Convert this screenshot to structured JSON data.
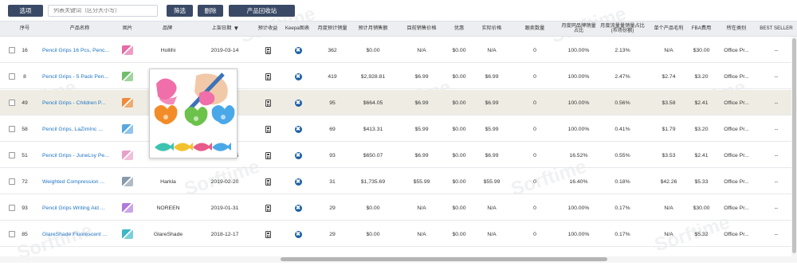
{
  "toolbar": {
    "options_label": "选项",
    "search_placeholder": "列表关键词（区分大小写）",
    "filter_label": "筛选",
    "delete_label": "删除",
    "recycle_label": "产品回收站"
  },
  "watermark_text": "Sorftime",
  "columns": [
    "序号",
    "产品名称",
    "图片",
    "品牌",
    "上架日期",
    "预计收益",
    "Keepa图表",
    "月度预计销量",
    "预计月销售额",
    "目前销售价格",
    "优惠",
    "实际价格",
    "跟卖数量",
    "月度同品牌销量占比",
    "月度流量量销量占比(市场份额)",
    "单个产品毛利",
    "FBA费用",
    "所在类别",
    "BEST SELLER"
  ],
  "sort_indicator": "▼",
  "rows": [
    {
      "no": "16",
      "name": "Pencil Grips 16 Pcs, Penc...",
      "brand": "Hollihi",
      "date": "2019-03-14",
      "sales": "362",
      "revenue": "$0.00",
      "price": "N/A",
      "discount": "$0.00",
      "actual": "N/A",
      "sellers": "0",
      "brand_share": "100.00%",
      "market_share": "2.13%",
      "profit": "N/A",
      "fba": "$30.00",
      "category": "Office Pr...",
      "best": "--"
    },
    {
      "no": "8",
      "name": "Pencil Grips - 5 Pack Pen...",
      "brand": "",
      "date": "3",
      "sales": "419",
      "revenue": "$2,928.81",
      "price": "$6.99",
      "discount": "$0.00",
      "actual": "$6.99",
      "sellers": "0",
      "brand_share": "100.00%",
      "market_share": "2.47%",
      "profit": "$2.74",
      "fba": "$3.20",
      "category": "Office Pr...",
      "best": "--"
    },
    {
      "no": "49",
      "name": "Pencil Grips - Children P...",
      "brand": "",
      "date": "2",
      "sales": "95",
      "revenue": "$664.05",
      "price": "$6.99",
      "discount": "$0.00",
      "actual": "$6.99",
      "sellers": "0",
      "brand_share": "100.00%",
      "market_share": "0.56%",
      "profit": "$3.58",
      "fba": "$2.41",
      "category": "Office Pr...",
      "best": "--"
    },
    {
      "no": "58",
      "name": "Pencil Grips, LaZimInc ...",
      "brand": "",
      "date": "1",
      "sales": "69",
      "revenue": "$413.31",
      "price": "$5.99",
      "discount": "$0.00",
      "actual": "$5.99",
      "sellers": "0",
      "brand_share": "100.00%",
      "market_share": "0.41%",
      "profit": "$1.79",
      "fba": "$3.20",
      "category": "Office Pr...",
      "best": "--"
    },
    {
      "no": "51",
      "name": "Pencil Grips - JuneLsy Pe...",
      "brand": "JuneLsy",
      "date": "2019-05-05",
      "sales": "93",
      "revenue": "$650.07",
      "price": "$6.99",
      "discount": "$0.00",
      "actual": "$6.99",
      "sellers": "0",
      "brand_share": "16.52%",
      "market_share": "0.55%",
      "profit": "$3.53",
      "fba": "$2.41",
      "category": "Office Pr...",
      "best": "--"
    },
    {
      "no": "72",
      "name": "Weighted Compression ...",
      "brand": "Harkla",
      "date": "2019-02-20",
      "sales": "31",
      "revenue": "$1,735.69",
      "price": "$55.99",
      "discount": "$0.00",
      "actual": "$55.99",
      "sellers": "0",
      "brand_share": "16.40%",
      "market_share": "0.18%",
      "profit": "$42.26",
      "fba": "$5.33",
      "category": "Office Pr...",
      "best": "--"
    },
    {
      "no": "93",
      "name": "Pencil Grips Writing Aid ...",
      "brand": "NOREEN",
      "date": "2019-01-31",
      "sales": "29",
      "revenue": "$0.00",
      "price": "N/A",
      "discount": "$0.00",
      "actual": "N/A",
      "sellers": "0",
      "brand_share": "100.00%",
      "market_share": "0.17%",
      "profit": "N/A",
      "fba": "$30.00",
      "category": "Office Pr...",
      "best": "--"
    },
    {
      "no": "85",
      "name": "GlareShade Fluorescent ...",
      "brand": "GlareShade",
      "date": "2018-12-17",
      "sales": "29",
      "revenue": "$0.00",
      "price": "N/A",
      "discount": "$0.00",
      "actual": "N/A",
      "sellers": "0",
      "brand_share": "100.00%",
      "market_share": "0.17%",
      "profit": "N/A",
      "fba": "$5.32",
      "category": "Office Pr...",
      "best": "--"
    }
  ],
  "thumb_colors": [
    "#e66aa5",
    "#6fbf6a",
    "#ef8a3a",
    "#58a7e0",
    "#e8a0c8",
    "#8899aa",
    "#b07adb",
    "#3bb7c9"
  ],
  "popup_grip_colors": [
    "#f06ea9",
    "#f28c28",
    "#6cc24a",
    "#4aa8e8",
    "#3cc4b0",
    "#f2c12e",
    "#e85a8a"
  ]
}
